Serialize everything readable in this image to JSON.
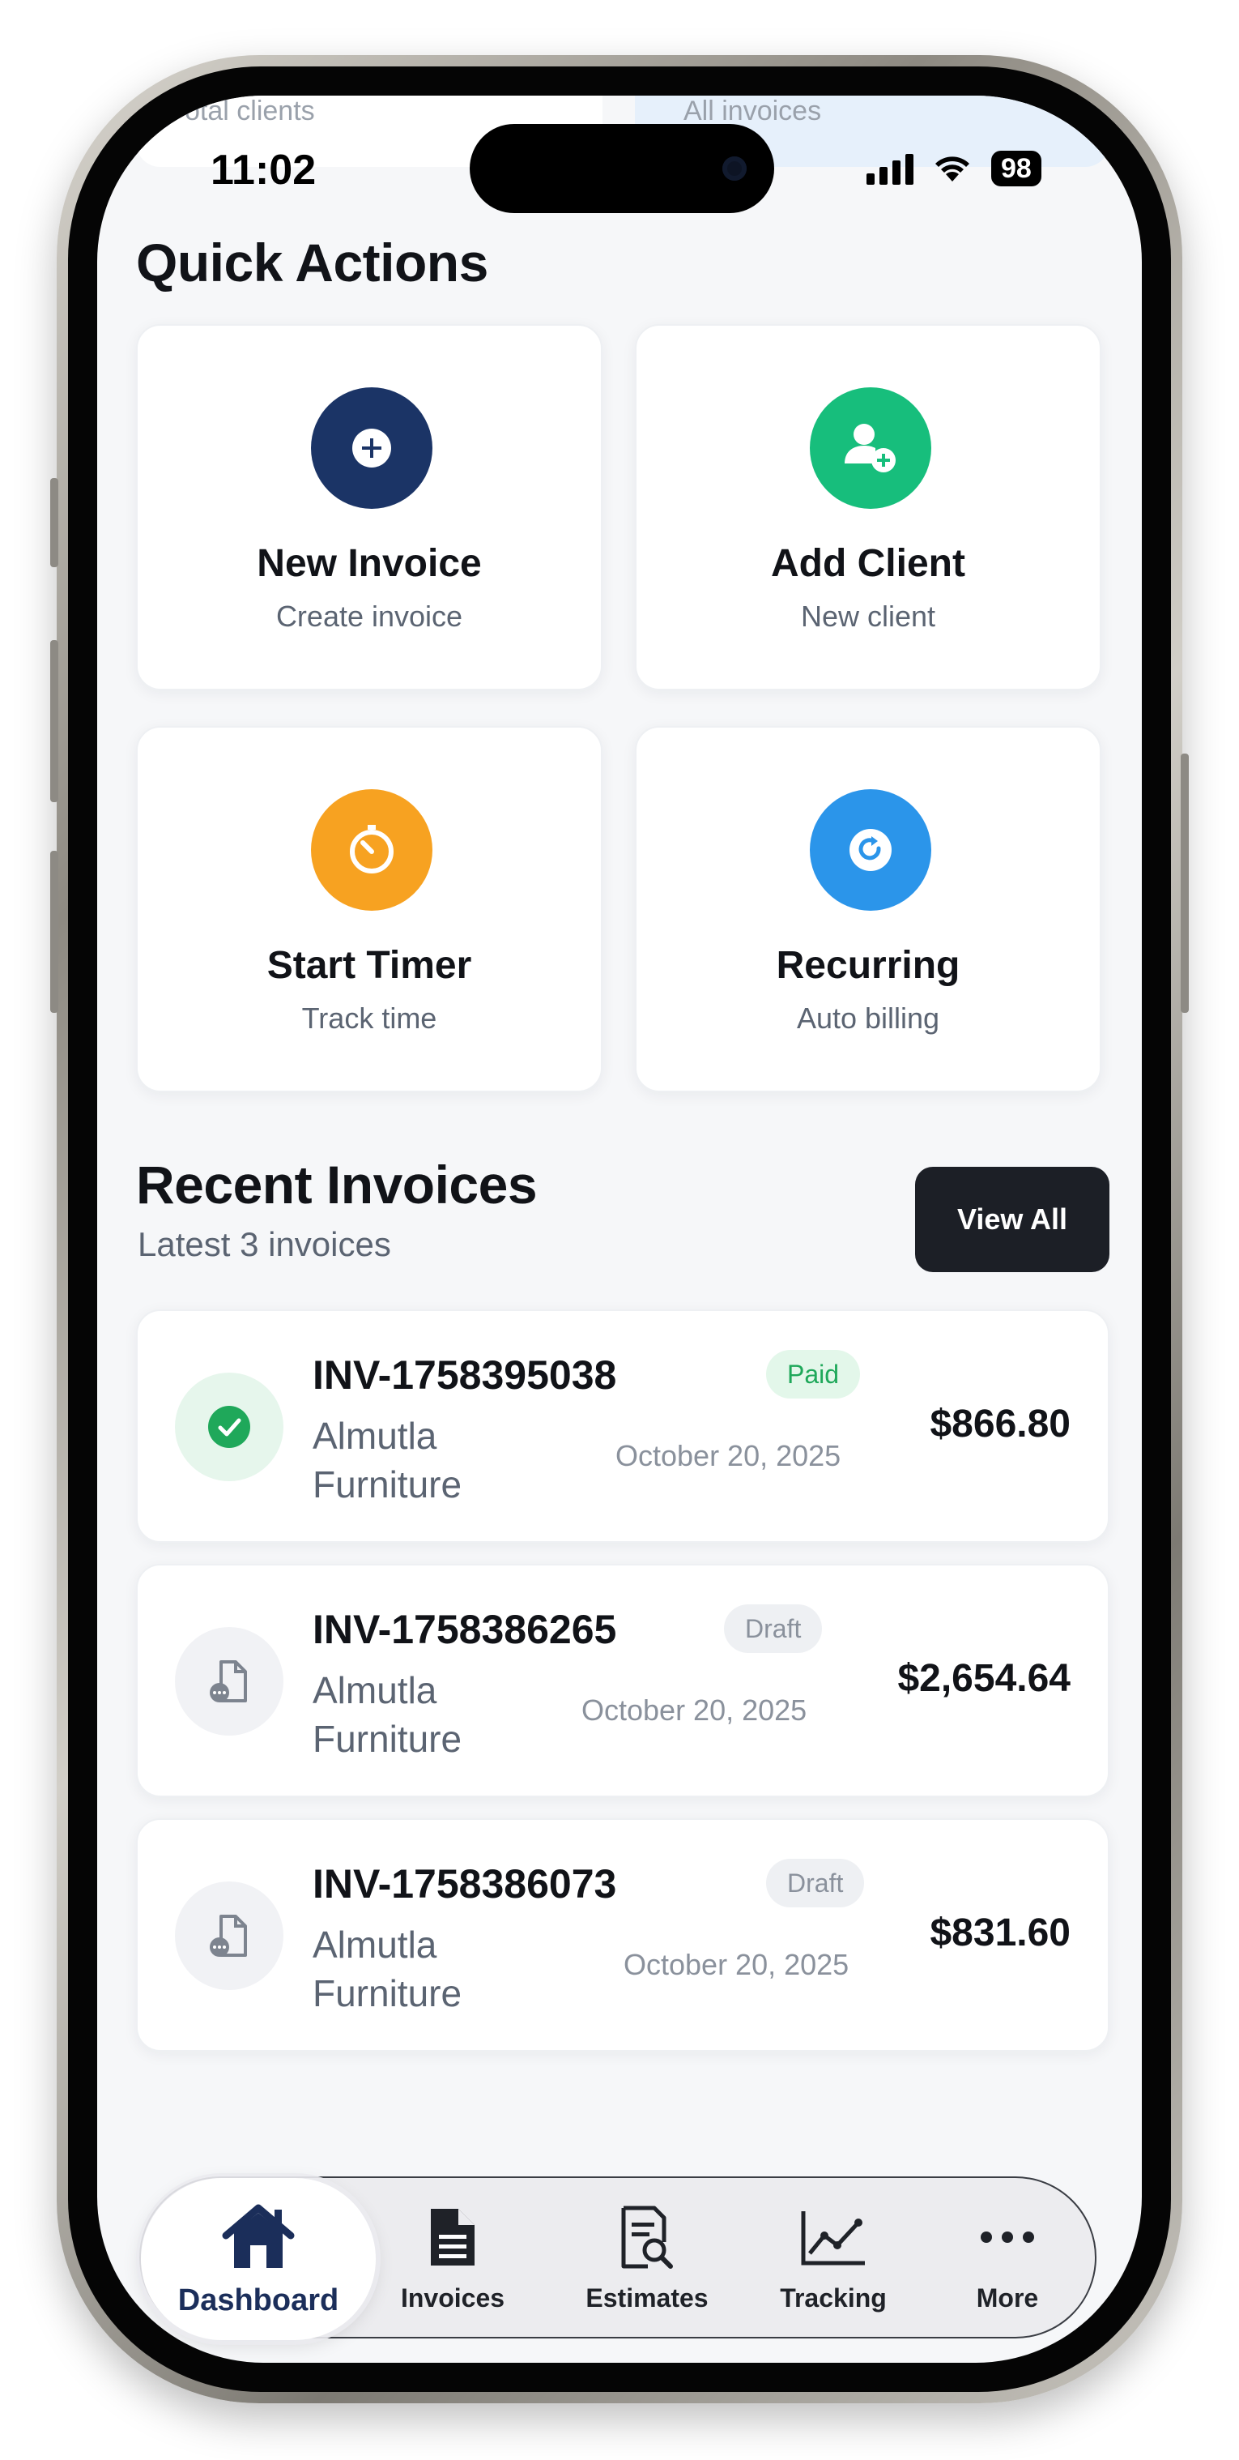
{
  "status_bar": {
    "time": "11:02",
    "battery": "98",
    "ghost_left": "otal clients",
    "ghost_right": "All invoices"
  },
  "quick_actions": {
    "title": "Quick Actions",
    "items": [
      {
        "label": "New Invoice",
        "sub": "Create invoice",
        "icon": "plus-circle-icon",
        "color": "#1b3466"
      },
      {
        "label": "Add Client",
        "sub": "New client",
        "icon": "user-add-icon",
        "color": "#17be7c"
      },
      {
        "label": "Start Timer",
        "sub": "Track time",
        "icon": "timer-icon",
        "color": "#f7a221"
      },
      {
        "label": "Recurring",
        "sub": "Auto billing",
        "icon": "refresh-icon",
        "color": "#2b95ea"
      }
    ]
  },
  "recent_invoices": {
    "title": "Recent Invoices",
    "subtitle": "Latest 3 invoices",
    "view_all": "View All",
    "items": [
      {
        "number": "INV-1758395038",
        "client": "Almutla Furniture",
        "status": "Paid",
        "date": "October 20, 2025",
        "amount": "$866.80"
      },
      {
        "number": "INV-1758386265",
        "client": "Almutla Furniture",
        "status": "Draft",
        "date": "October 20, 2025",
        "amount": "$2,654.64"
      },
      {
        "number": "INV-1758386073",
        "client": "Almutla Furniture",
        "status": "Draft",
        "date": "October 20, 2025",
        "amount": "$831.60"
      }
    ]
  },
  "tab_bar": {
    "active": "Dashboard",
    "tabs": [
      {
        "label": "Dashboard",
        "icon": "home-icon"
      },
      {
        "label": "Invoices",
        "icon": "document-icon"
      },
      {
        "label": "Estimates",
        "icon": "document-search-icon"
      },
      {
        "label": "Tracking",
        "icon": "line-chart-icon"
      },
      {
        "label": "More",
        "icon": "more-dots-icon"
      }
    ]
  },
  "colors": {
    "primary": "#1b3466",
    "paid": "#1fa85a",
    "background": "#f6f7f9"
  }
}
